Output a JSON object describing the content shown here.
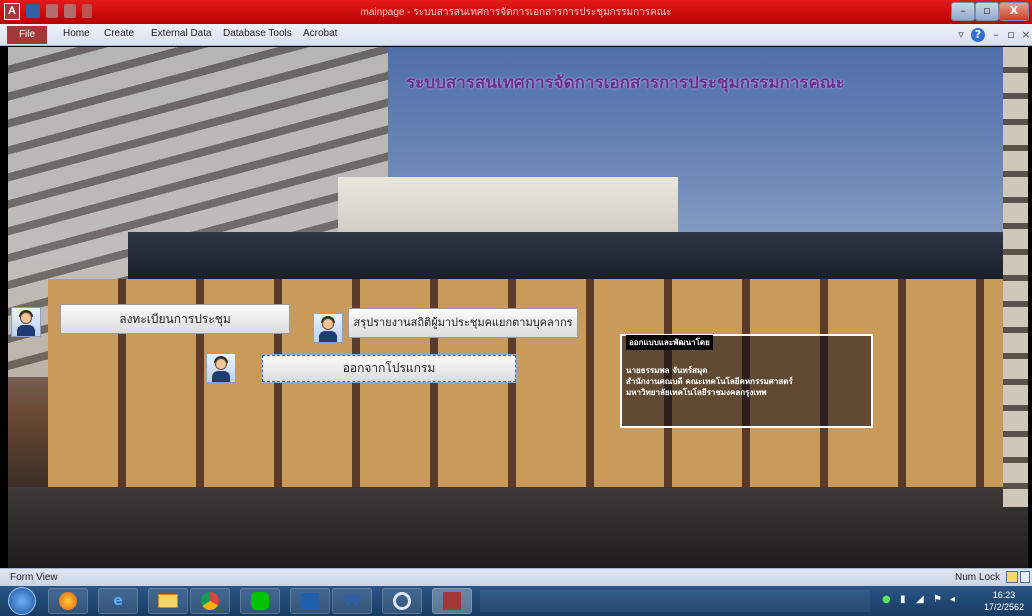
{
  "window": {
    "title": "mainpage - ระบบสารสนเทศการจัดการเอกสารการประชุมกรรมการคณะ",
    "app_icon_letter": "A",
    "minimize": "–",
    "restore": "▫",
    "close": "X"
  },
  "ribbon": {
    "file_label": "File",
    "tabs": [
      "Home",
      "Create",
      "External Data",
      "Database Tools",
      "Acrobat"
    ],
    "help_icon": "?"
  },
  "form": {
    "title": "ระบบสารสนเทศการจัดการเอกสารการประชุมกรรมการคณะ",
    "buttons": {
      "register": "ลงทะเบียนการประชุม",
      "summary": "สรุปรายงานสถิติผู้มาประชุมคแยกตามบุคลากร",
      "exit": "ออกจากโปรแกรม"
    },
    "credit": {
      "label": "ออกแบบและพัฒนาโดย",
      "line1": "นายธรรมพล  จันทร์สมุด",
      "line2": "สำนักงานคณบดี  คณะเทคโนโลยีคหกรรมศาสตร์",
      "line3": "มหาวิทยาลัยเทคโนโลยีราชมงคลกรุงเทพ"
    }
  },
  "statusbar": {
    "left": "Form View",
    "right": "Num Lock"
  },
  "taskbar": {
    "apps": [
      "start-orb-icon",
      "firefox-icon",
      "ie-icon",
      "explorer-icon",
      "chrome-icon",
      "line-icon",
      "outlook-icon",
      "word-icon",
      "app-icon",
      "access-icon"
    ],
    "word_letter": "W",
    "clock_time": "16:23",
    "clock_date": "17/2/2562"
  },
  "colors": {
    "titlebar": "#d00000",
    "form_title": "#6a2f8f",
    "taskbar": "#1f4a7a"
  }
}
